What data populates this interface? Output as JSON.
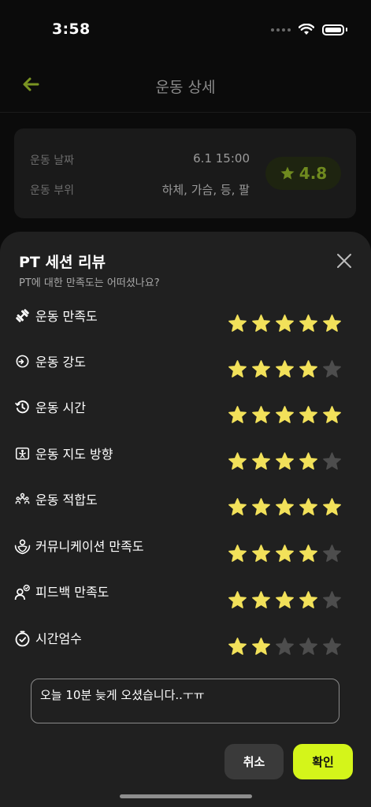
{
  "status_bar": {
    "time": "3:58"
  },
  "header": {
    "title": "운동 상세"
  },
  "summary": {
    "date_label": "운동 날짜",
    "date_value": "6.1 15:00",
    "part_label": "운동 부위",
    "part_value": "하체, 가슴, 등, 팔",
    "rating": "4.8"
  },
  "sheet": {
    "title": "PT 세션 리뷰",
    "subtitle": "PT에 대한 만족도는 어떠셨나요?",
    "categories": [
      {
        "label": "운동 만족도",
        "icon": "dumbbell-icon",
        "rating": 5
      },
      {
        "label": "운동 강도",
        "icon": "intensity-gauge-icon",
        "rating": 4
      },
      {
        "label": "운동 시간",
        "icon": "history-clock-icon",
        "rating": 5
      },
      {
        "label": "운동 지도 방향",
        "icon": "guidance-icon",
        "rating": 4
      },
      {
        "label": "운동 적합도",
        "icon": "people-fit-icon",
        "rating": 5
      },
      {
        "label": "커뮤니케이션 만족도",
        "icon": "communication-icon",
        "rating": 4
      },
      {
        "label": "피드백 만족도",
        "icon": "feedback-person-icon",
        "rating": 4
      },
      {
        "label": "시간엄수",
        "icon": "punctuality-clock-icon",
        "rating": 2
      }
    ],
    "comment": "오늘 10분 늦게 오셨습니다..ㅜㅠ",
    "cancel_label": "취소",
    "confirm_label": "확인"
  },
  "colors": {
    "accent": "#d4f51a",
    "star_filled": "#f2e15a",
    "star_empty": "#4d4d4d",
    "sheet_bg": "#202020",
    "background": "#0b0b0b"
  }
}
